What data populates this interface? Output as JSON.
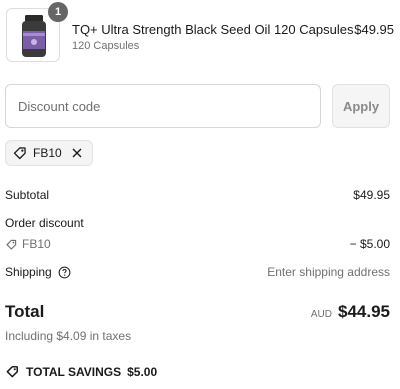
{
  "product": {
    "title": "TQ+ Ultra Strength Black Seed Oil 120 Capsules",
    "variant": "120 Capsules",
    "price": "$49.95",
    "quantity": "1",
    "image_icon": "supplement-bottle-icon"
  },
  "discount": {
    "placeholder": "Discount code",
    "apply_label": "Apply",
    "applied_code": "FB10"
  },
  "summary": {
    "subtotal_label": "Subtotal",
    "subtotal_value": "$49.95",
    "order_discount_label": "Order discount",
    "discount_code": "FB10",
    "discount_value": "− $5.00",
    "shipping_label": "Shipping",
    "shipping_value": "Enter shipping address",
    "total_label": "Total",
    "currency": "AUD",
    "total_value": "$44.95",
    "taxes_note": "Including $4.09 in taxes",
    "savings_label": "TOTAL SAVINGS",
    "savings_value": "$5.00"
  },
  "colors": {
    "text": "#1a1a1a",
    "muted": "#707070",
    "badge": "#666666",
    "bottle_label": "#7b5ea7"
  }
}
